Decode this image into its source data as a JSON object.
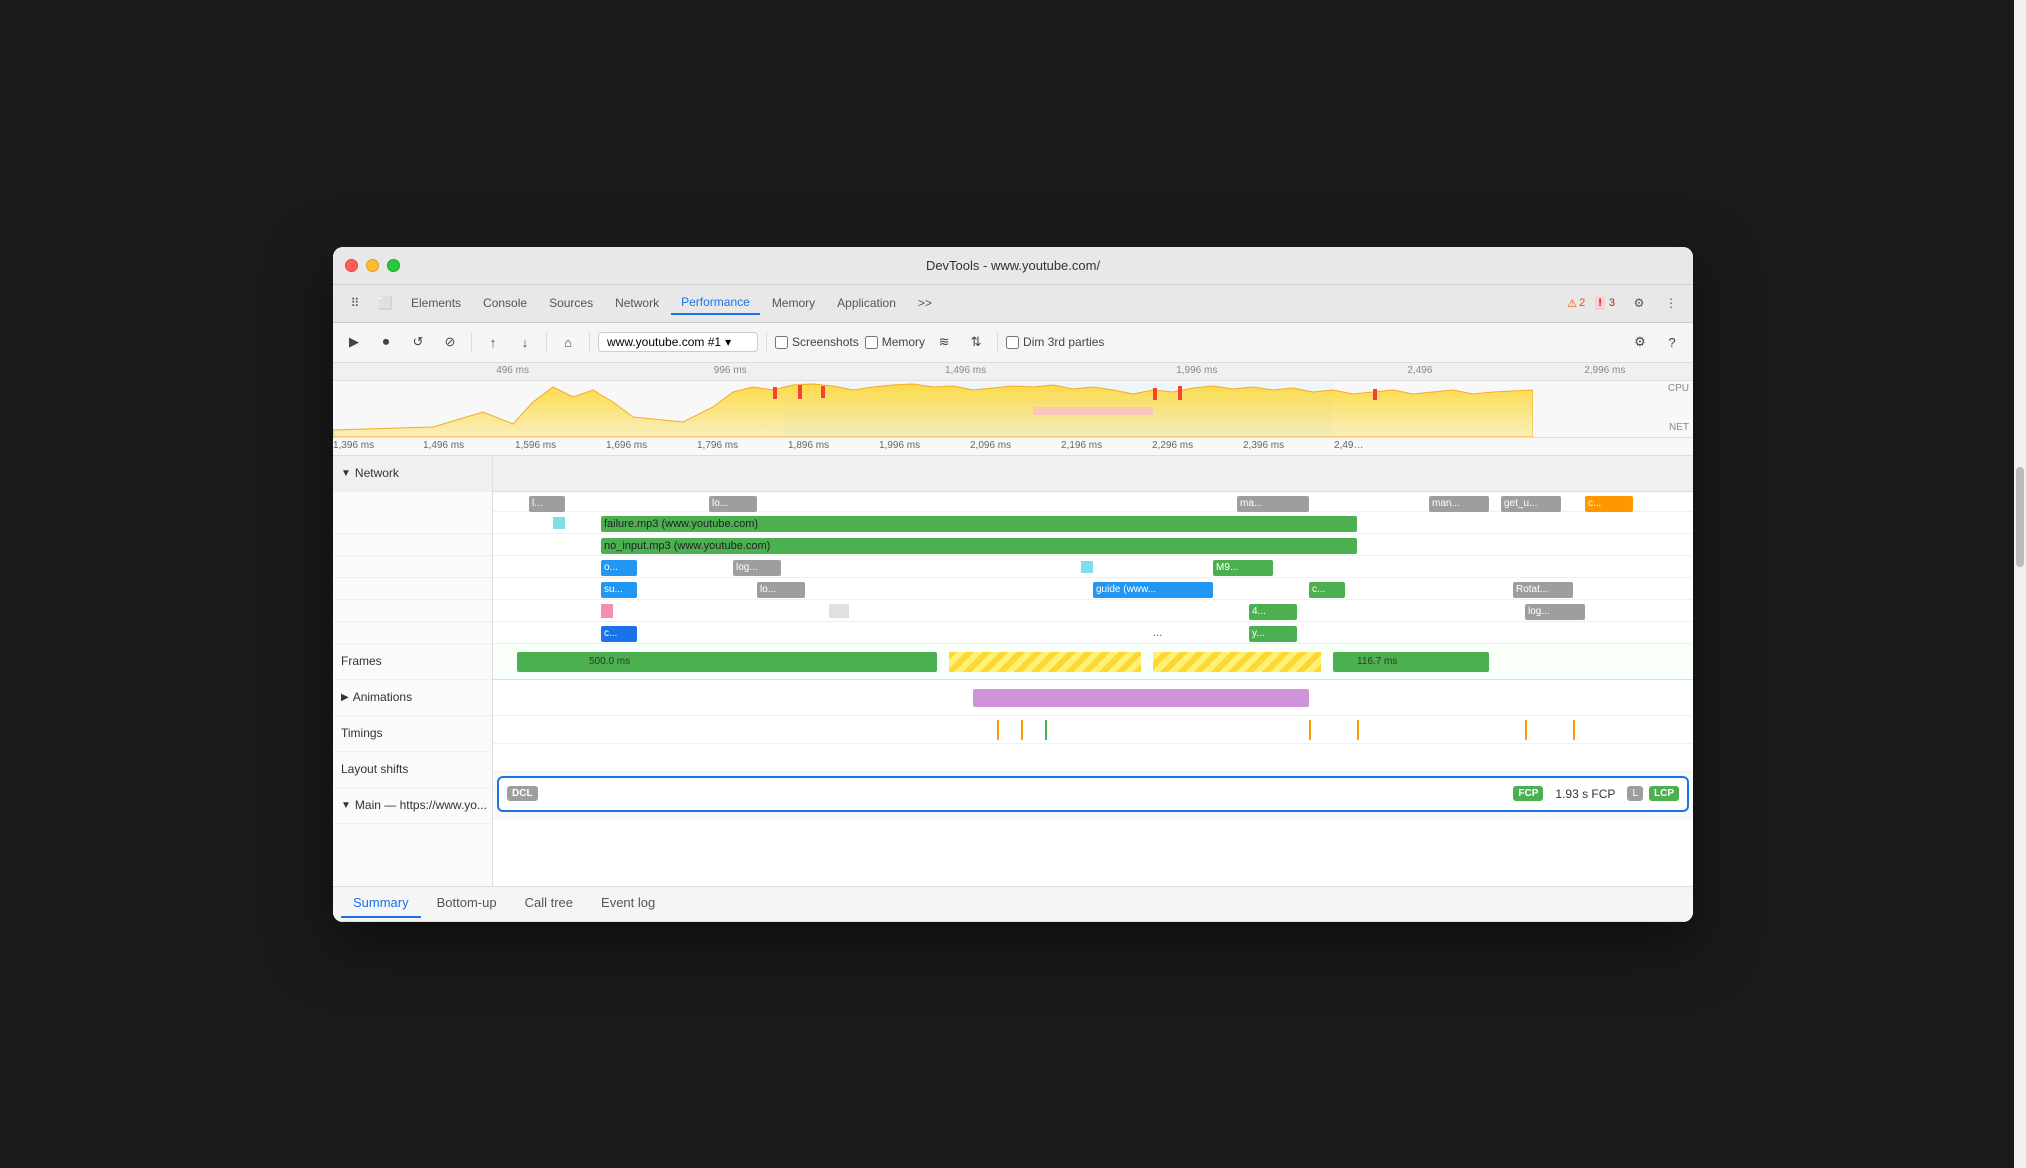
{
  "window": {
    "title": "DevTools - www.youtube.com/"
  },
  "tabs": {
    "items": [
      "Elements",
      "Console",
      "Sources",
      "Network",
      "Performance",
      "Memory",
      "Application",
      ">>"
    ],
    "active": "Performance"
  },
  "toolbar": {
    "url": "www.youtube.com #1",
    "checkboxes": [
      "Screenshots",
      "Memory",
      "Dim 3rd parties"
    ],
    "warnings": "2",
    "errors": "3"
  },
  "overview": {
    "ticks": [
      "496 ms",
      "996 ms",
      "1,496 ms",
      "1,996 ms",
      "2,496",
      "2,996 ms"
    ],
    "cpu_label": "CPU",
    "net_label": "NET"
  },
  "ruler": {
    "ticks": [
      "1,396 ms",
      "1,496 ms",
      "1,596 ms",
      "1,696 ms",
      "1,796 ms",
      "1,896 ms",
      "1,996 ms",
      "2,096 ms",
      "2,196 ms",
      "2,296 ms",
      "2,396 ms",
      "2,49…"
    ]
  },
  "sections": {
    "network": {
      "label": "Network",
      "rows": [
        {
          "label": "l...",
          "bars": [
            {
              "text": "l...",
              "color": "gray",
              "left": "5%",
              "width": "4%"
            },
            {
              "text": "lo...",
              "color": "gray",
              "left": "20%",
              "width": "5%"
            },
            {
              "text": "ma...",
              "color": "gray",
              "left": "65%",
              "width": "7%"
            },
            {
              "text": "man...",
              "color": "gray",
              "left": "80%",
              "width": "5%"
            },
            {
              "text": "get_u...",
              "color": "gray",
              "left": "86%",
              "width": "5%"
            },
            {
              "text": "c...",
              "color": "yellow",
              "left": "95%",
              "width": "4%"
            }
          ]
        },
        {
          "label": "failure.mp3 (www.youtube.com)",
          "bars": [
            {
              "text": "failure.mp3 (www.youtube.com)",
              "color": "green",
              "left": "12%",
              "width": "60%"
            }
          ]
        },
        {
          "label": "no_input.mp3 (www.youtube.com)",
          "bars": [
            {
              "text": "no_input.mp3 (www.youtube.com)",
              "color": "green",
              "left": "12%",
              "width": "60%"
            }
          ]
        },
        {
          "label": "o...",
          "bars": [
            {
              "text": "o...",
              "color": "blue",
              "left": "12%",
              "width": "4%"
            },
            {
              "text": "log...",
              "color": "gray",
              "left": "22%",
              "width": "5%"
            },
            {
              "text": "M9...",
              "color": "green",
              "left": "63%",
              "width": "6%"
            }
          ]
        },
        {
          "label": "su...",
          "bars": [
            {
              "text": "su...",
              "color": "blue",
              "left": "12%",
              "width": "4%"
            },
            {
              "text": "lo...",
              "color": "gray",
              "left": "24%",
              "width": "5%"
            },
            {
              "text": "guide (www...",
              "color": "blue",
              "left": "52%",
              "width": "10%"
            },
            {
              "text": "c...",
              "color": "green",
              "left": "70%",
              "width": "4%"
            },
            {
              "text": "Rotat...",
              "color": "gray",
              "left": "86%",
              "width": "6%"
            }
          ]
        },
        {
          "label": "c...",
          "bars": [
            {
              "text": "c...",
              "color": "pink",
              "left": "12%",
              "width": "3%"
            },
            {
              "text": "4...",
              "color": "green",
              "left": "65%",
              "width": "5%"
            },
            {
              "text": "log...",
              "color": "gray",
              "left": "87%",
              "width": "5%"
            }
          ]
        },
        {
          "label": "",
          "bars": [
            {
              "text": "y...",
              "color": "green",
              "left": "65%",
              "width": "5%"
            }
          ]
        }
      ]
    },
    "frames": {
      "label": "Frames",
      "items": [
        {
          "type": "green",
          "left": "2%",
          "width": "37%",
          "label": "500.0 ms"
        },
        {
          "type": "stripe",
          "left": "40%",
          "width": "15%"
        },
        {
          "type": "stripe",
          "left": "56%",
          "width": "14%"
        },
        {
          "type": "green",
          "left": "71%",
          "width": "13%",
          "label": "116.7 ms"
        }
      ]
    },
    "animations": {
      "label": "Animations"
    },
    "timings": {
      "label": "Timings"
    },
    "layout_shifts": {
      "label": "Layout shifts"
    },
    "main": {
      "label": "Main — https://www.yo..."
    }
  },
  "markers": {
    "dcl": "DCL",
    "fcp": "FCP",
    "fcp_time": "1.93 s FCP",
    "l": "L",
    "lcp": "LCP"
  },
  "bottom_tabs": {
    "items": [
      "Summary",
      "Bottom-up",
      "Call tree",
      "Event log"
    ],
    "active": "Summary"
  }
}
